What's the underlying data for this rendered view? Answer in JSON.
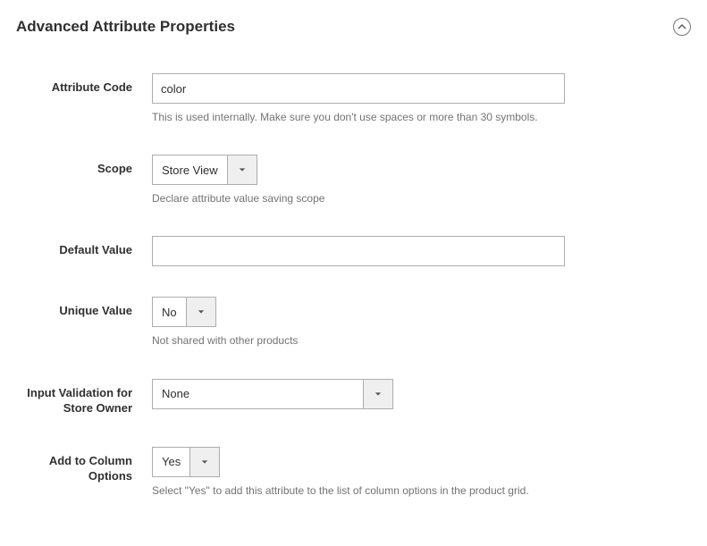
{
  "section": {
    "title": "Advanced Attribute Properties"
  },
  "fields": {
    "attribute_code": {
      "label": "Attribute Code",
      "value": "color",
      "note": "This is used internally. Make sure you don't use spaces or more than 30 symbols."
    },
    "scope": {
      "label": "Scope",
      "value": "Store View",
      "note": "Declare attribute value saving scope"
    },
    "default_value": {
      "label": "Default Value",
      "value": ""
    },
    "unique_value": {
      "label": "Unique Value",
      "value": "No",
      "note": "Not shared with other products"
    },
    "input_validation": {
      "label": "Input Validation for Store Owner",
      "value": "None"
    },
    "add_to_column": {
      "label": "Add to Column Options",
      "value": "Yes",
      "note": "Select \"Yes\" to add this attribute to the list of column options in the product grid."
    }
  }
}
